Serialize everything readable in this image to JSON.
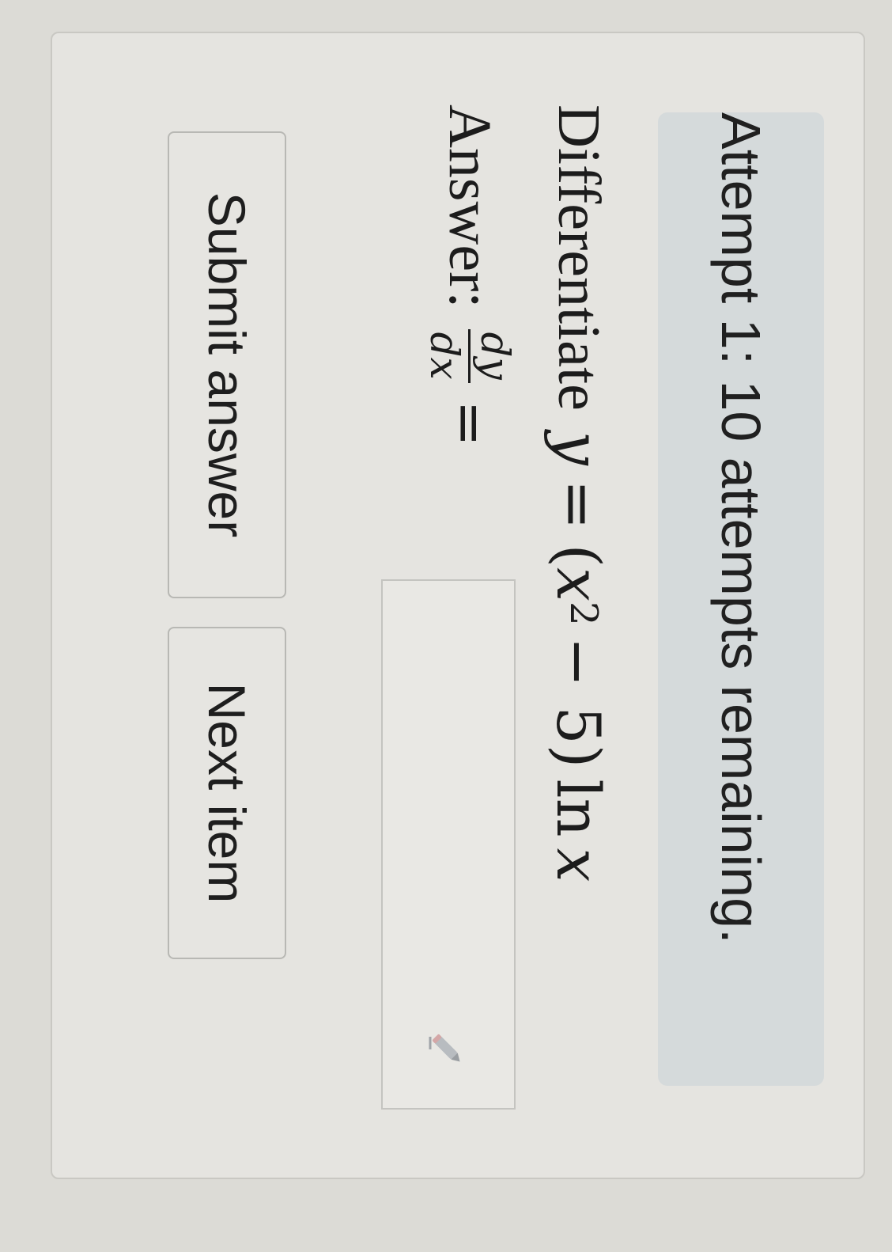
{
  "banner": {
    "text": "Attempt 1: 10 attempts remaining."
  },
  "question": {
    "prefix": "Differentiate",
    "y": "y",
    "equals": "=",
    "open_paren": "(",
    "x": "x",
    "exponent": "2",
    "minus_five": "− 5)",
    "ln": "ln",
    "x_end": "x"
  },
  "answer": {
    "label": "Answer:",
    "frac_numerator": "dy",
    "frac_denominator": "dx",
    "equals": "=",
    "input_value": "",
    "input_icon": "pencil-icon"
  },
  "buttons": {
    "submit_label": "Submit answer",
    "next_label": "Next item"
  }
}
